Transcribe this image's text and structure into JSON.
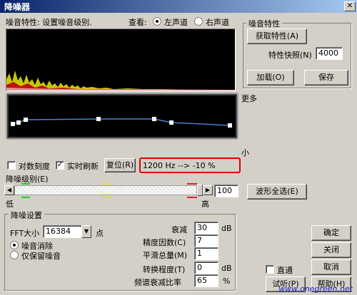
{
  "window": {
    "title": "降噪器",
    "close_glyph": "✕"
  },
  "top": {
    "noise_profile_label": "噪音特性: 设置噪音级别.",
    "view_label": "查看:",
    "left_channel": "左声道",
    "right_channel": "右声道"
  },
  "profile_group": {
    "title": "噪音特性",
    "get_profile": "获取特性(A)",
    "snapshots_label": "特性快照(N)",
    "snapshots_value": "4000",
    "load": "加载(O)",
    "save": "保存"
  },
  "graph": {
    "more_label": "更多",
    "less_label": "小"
  },
  "options": {
    "log_scale": "对数刻度",
    "live_update": "实时刷新",
    "reset": "复位(R)",
    "readout": "1200 Hz --> -10 %"
  },
  "level": {
    "label": "降噪级别(E)",
    "value": "100",
    "low": "低",
    "high": "高",
    "select_all": "波形全选(E)"
  },
  "settings": {
    "title": "降噪设置",
    "fft_label": "FFT大小",
    "fft_value": "16384",
    "fft_unit": "点",
    "remove_noise": "噪音消除",
    "keep_noise_only": "仅保留噪音",
    "reduction_label": "衰减",
    "reduction_value": "30",
    "reduction_unit": "dB",
    "precision_label": "精度因数(C)",
    "precision_value": "7",
    "smoothing_label": "平滑总量(M)",
    "smoothing_value": "1",
    "transition_label": "转换程度(T)",
    "transition_value": "0",
    "transition_unit": "dB",
    "spectral_label": "频谱衰减比率",
    "spectral_value": "65",
    "spectral_unit": "%"
  },
  "buttons": {
    "ok": "确定",
    "close": "关闭",
    "cancel": "取消",
    "bypass": "直通",
    "preview": "试听(P)",
    "help": "帮助(H)"
  },
  "watermark": "www.onegreen.net",
  "colors": {
    "curve_line": "#4a7fd4",
    "readout_highlight": "#e00000",
    "title_bar": "#0a246a"
  }
}
